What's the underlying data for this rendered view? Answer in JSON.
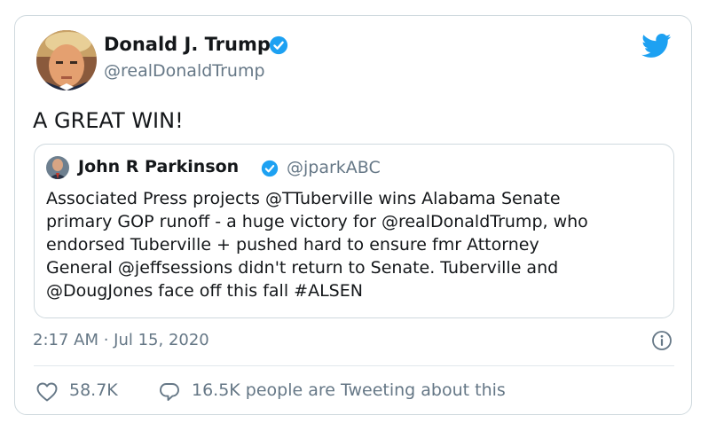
{
  "author": {
    "name": "Donald J. Trump",
    "handle": "@realDonaldTrump",
    "verified": true
  },
  "tweet": {
    "text": "A GREAT WIN!",
    "timestamp": "2:17 AM · Jul 15, 2020"
  },
  "quoted_tweet": {
    "author_name": "John R Parkinson",
    "author_handle": "@jparkABC",
    "verified": true,
    "text_lines": [
      "Associated Press projects @TTuberville wins Alabama Senate",
      "primary GOP runoff - a huge victory for @realDonaldTrump, who",
      "endorsed Tuberville + pushed hard to ensure fmr Attorney",
      "General @jeffsessions didn't return to Senate. Tuberville and",
      "@DougJones face off this fall #ALSEN"
    ]
  },
  "engagement": {
    "likes": "58.7K",
    "tweeting": "16.5K people are Tweeting about this"
  },
  "icons": {
    "brand": "twitter-bird-icon",
    "verified": "verified-badge-icon",
    "info": "info-icon",
    "like": "heart-icon",
    "reply": "reply-bubble-icon"
  },
  "colors": {
    "brand_blue": "#1da1f2",
    "secondary_text": "#657786",
    "primary_text": "#14171a",
    "border": "#cfd9de"
  }
}
